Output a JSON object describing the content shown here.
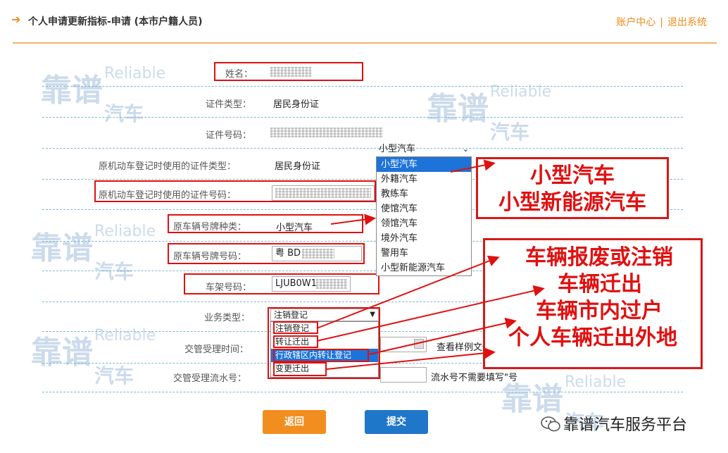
{
  "header": {
    "title": "个人申请更新指标-申请 (本市户籍人员)",
    "links": [
      "账户中心",
      "退出系统"
    ],
    "separator": "|"
  },
  "form": {
    "name_label": "姓名：",
    "id_type_label": "证件类型：",
    "id_type_value": "居民身份证",
    "id_number_label": "证件号码：",
    "orig_id_type_label": "原机动车登记时使用的证件类型：",
    "orig_id_type_value": "居民身份证",
    "orig_id_number_label": "原机动车登记时使用的证件号码：",
    "plate_type_label": "原车辆号牌种类：",
    "plate_type_value": "小型汽车",
    "plate_number_label": "原车辆号牌号码：",
    "plate_number_value": "粤 BD",
    "vin_label": "车架号码：",
    "vin_value": "LJUB0W1",
    "business_type_label": "业务类型：",
    "business_type_value": "注销登记",
    "accept_time_label": "交管受理时间：",
    "sample_link": "查看样例文件",
    "serial_label": "交管受理流水号：",
    "serial_hint": "流水号不需要填写\"号"
  },
  "plate_select": {
    "current": "小型汽车",
    "options": [
      "小型汽车",
      "外籍汽车",
      "教练车",
      "使馆汽车",
      "领馆汽车",
      "境外汽车",
      "警用车",
      "小型新能源汽车"
    ],
    "highlighted_index": 0
  },
  "business_select": {
    "options": [
      "注销登记",
      "转让迁出",
      "行政辖区内转让登记",
      "变更迁出"
    ],
    "highlighted_index": 2
  },
  "annotations": {
    "plate_types": [
      "小型汽车",
      "小型新能源汽车"
    ],
    "business_types": [
      "车辆报废或注销",
      "车辆迁出",
      "车辆市内过户",
      "个人车辆迁出外地"
    ]
  },
  "buttons": {
    "back": "返回",
    "submit": "提交"
  },
  "watermark": {
    "cn": "靠谱",
    "en": "Reliable",
    "cn2": "汽车"
  },
  "wechat_account": "靠谱汽车服务平台",
  "colors": {
    "accent_orange": "#f08a1a",
    "annotation_red": "#e01010",
    "select_blue": "#1e73d8",
    "submit_blue": "#1f77c9"
  }
}
